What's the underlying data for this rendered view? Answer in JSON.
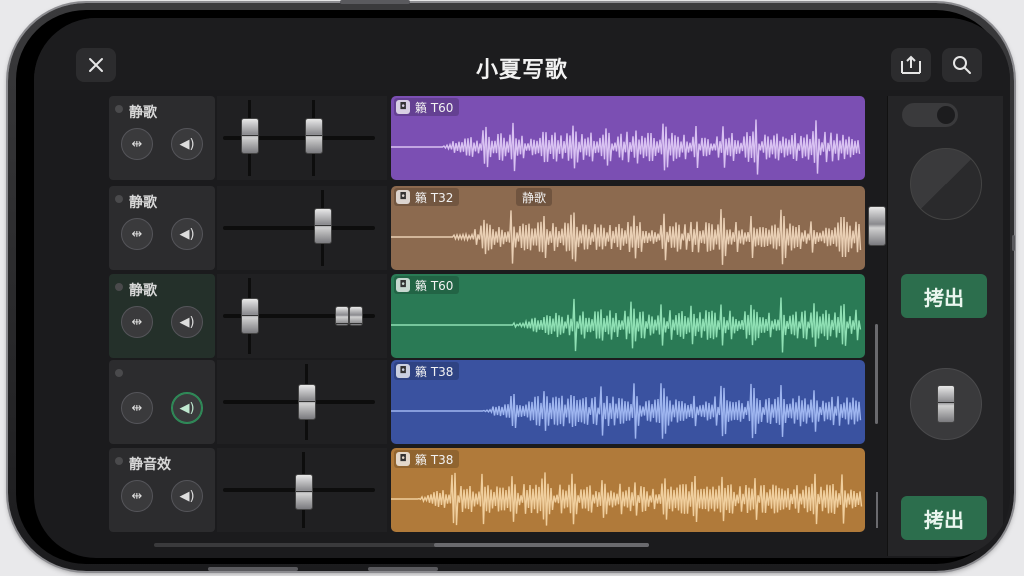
{
  "app": {
    "title": "小夏写歌"
  },
  "header": {
    "close_icon": "close-icon",
    "share_icon": "share-icon",
    "search_icon": "search-icon"
  },
  "tracks": [
    {
      "name": "静歌",
      "region_label": "籟 T60",
      "region_extra": "",
      "color": "#7b4fb3",
      "wave_color": "#d9c2f2",
      "fader1_level": 0.15,
      "fader2_level": 0.55,
      "speaker_active": false
    },
    {
      "name": "静歌",
      "region_label": "籟 T32",
      "region_extra": "静歌",
      "color": "#8c6a4f",
      "wave_color": "#e9cfb4",
      "fader1_level": null,
      "fader2_level": 0.62,
      "speaker_active": false
    },
    {
      "name": "静歌",
      "region_label": "籟 T60",
      "region_extra": "",
      "color": "#2a7a55",
      "wave_color": "#8fe0b4",
      "fader1_level": 0.15,
      "fader2_level": 0.75,
      "speaker_active": false
    },
    {
      "name": "",
      "region_label": "籟 T38",
      "region_extra": "",
      "color": "#3a52a0",
      "wave_color": "#9fb6f0",
      "fader1_level": null,
      "fader2_level": 0.55,
      "speaker_active": true
    },
    {
      "name": "静音效",
      "region_label": "籟 T38",
      "region_extra": "",
      "color": "#b07a3a",
      "wave_color": "#f0cf9e",
      "fader1_level": null,
      "fader2_level": 0.55,
      "speaker_active": false
    }
  ],
  "right_panel": {
    "button1_label": "拷出",
    "button2_label": "拷出"
  }
}
